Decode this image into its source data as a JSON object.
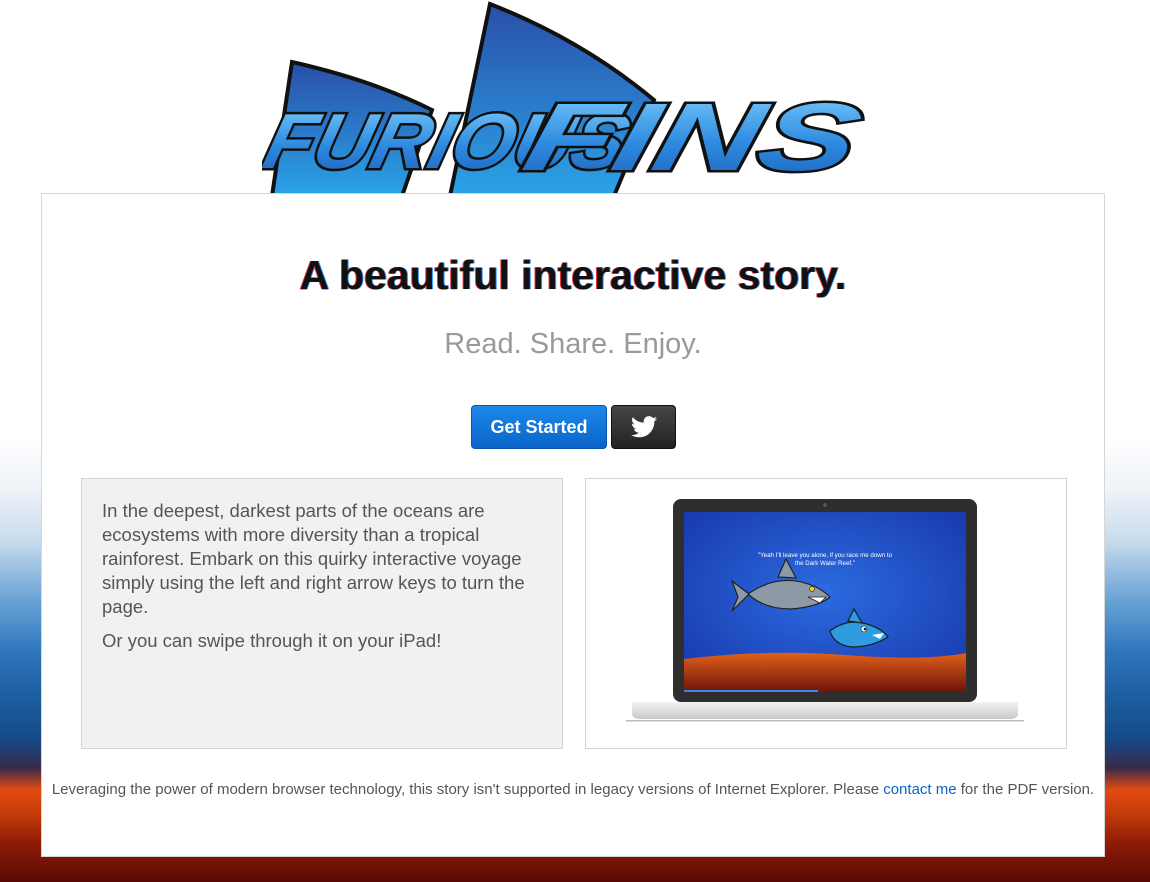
{
  "brand": {
    "logo_text_1": "FURIOUS",
    "logo_text_2": "FINS"
  },
  "hero": {
    "headline": "A beautiful interactive story.",
    "tagline": "Read. Share. Enjoy."
  },
  "actions": {
    "get_started_label": "Get Started",
    "twitter_icon": "twitter-bird-icon"
  },
  "description": {
    "paragraph_1": "In the deepest, darkest parts of the oceans are ecosystems with more diversity than a tropical rainforest. Embark on this quirky interactive voyage simply using the left and right arrow keys to turn the page.",
    "paragraph_2": "Or you can swipe through it on your iPad!"
  },
  "preview": {
    "quote_line_1": "\"Yeah I'll leave you alone, if you race me down to",
    "quote_line_2": "the Dark Water Reef.\""
  },
  "footer": {
    "text_before": "Leveraging the power of modern browser technology, this story isn't supported in legacy versions of Internet Explorer. Please ",
    "link_text": "contact me",
    "text_after": " for the PDF version."
  },
  "colors": {
    "primary": "#0a63c9",
    "logo_blue": "#2f7bd0",
    "ocean_blue": "#1a4fc0",
    "seabed_orange": "#d0481a"
  }
}
